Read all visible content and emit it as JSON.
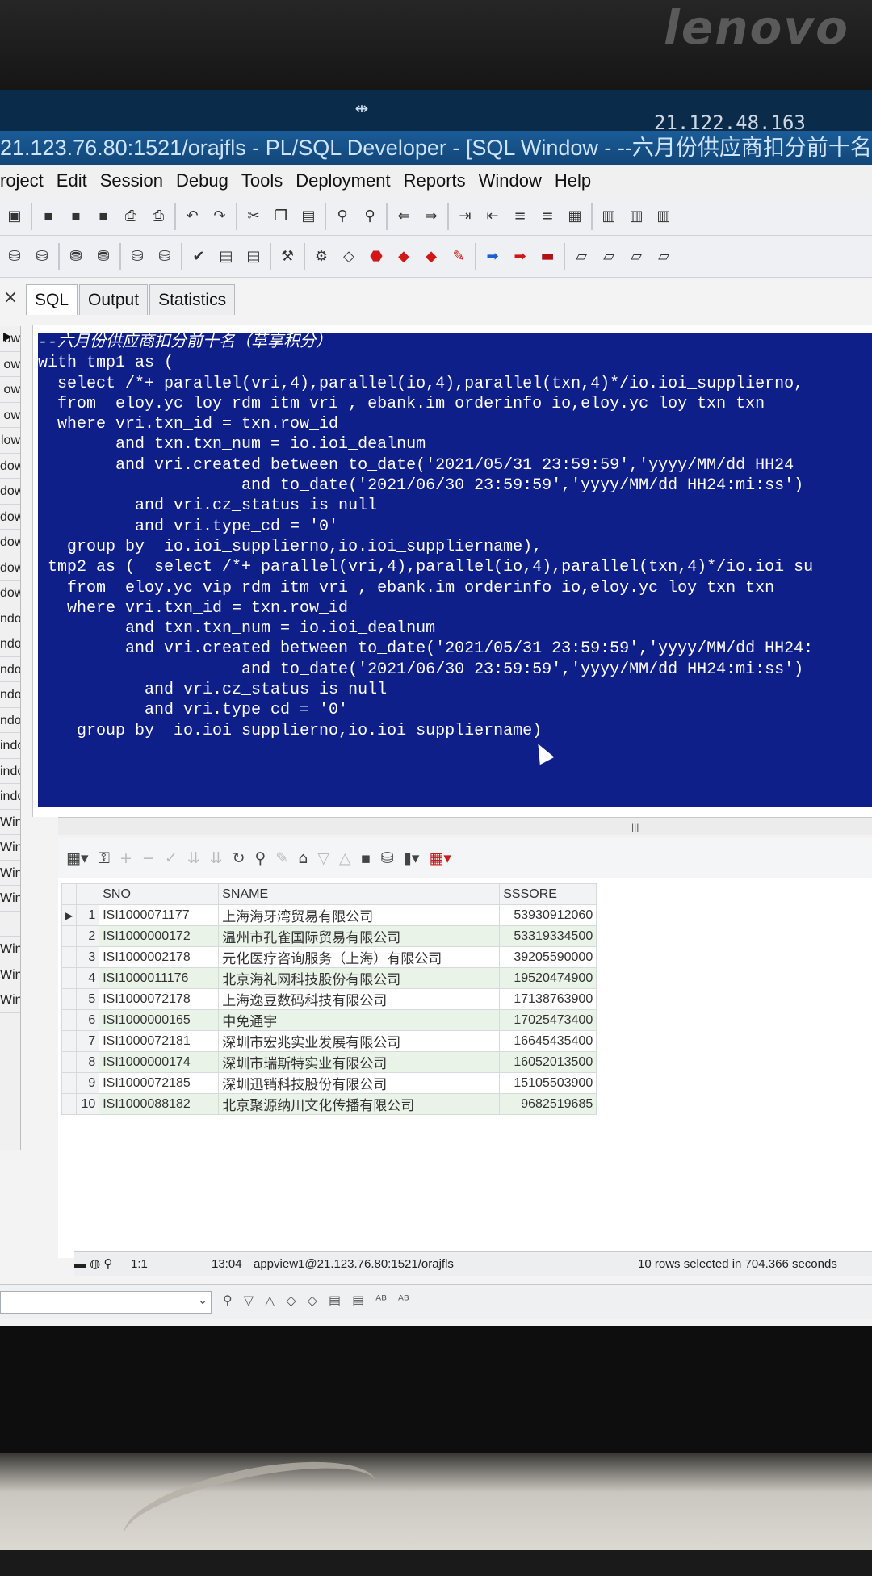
{
  "monitor": {
    "brand": "lenovo"
  },
  "remote": {
    "ip": "21.122.48.163"
  },
  "window": {
    "title": "21.123.76.80:1521/orajfls - PL/SQL Developer - [SQL Window - --六月份供应商扣分前十名 ("
  },
  "menu": [
    "roject",
    "Edit",
    "Session",
    "Debug",
    "Tools",
    "Deployment",
    "Reports",
    "Window",
    "Help"
  ],
  "tabs": [
    "SQL",
    "Output",
    "Statistics"
  ],
  "window_list": [
    "ow",
    "ow",
    "ow",
    "ow",
    "low",
    "dow",
    "dow",
    "dow",
    "dow",
    "dow",
    "dow",
    "ndow",
    "ndow",
    "ndow",
    "ndow",
    "ndow",
    "indow",
    "indow",
    "indow",
    "Window",
    "Window",
    "Window",
    "Window",
    "",
    "Window -",
    "Window -",
    "Window -"
  ],
  "code": [
    "--六月份供应商扣分前十名（草享积分）",
    "with tmp1 as (",
    "  select /*+ parallel(vri,4),parallel(io,4),parallel(txn,4)*/io.ioi_supplierno,",
    "  from  eloy.yc_loy_rdm_itm vri , ebank.im_orderinfo io,eloy.yc_loy_txn txn",
    "  where vri.txn_id = txn.row_id",
    "        and txn.txn_num = io.ioi_dealnum",
    "        and vri.created between to_date('2021/05/31 23:59:59','yyyy/MM/dd HH24",
    "                     and to_date('2021/06/30 23:59:59','yyyy/MM/dd HH24:mi:ss')",
    "          and vri.cz_status is null",
    "          and vri.type_cd = '0'",
    "   group by  io.ioi_supplierno,io.ioi_suppliername),",
    " tmp2 as (  select /*+ parallel(vri,4),parallel(io,4),parallel(txn,4)*/io.ioi_su",
    "   from  eloy.yc_vip_rdm_itm vri , ebank.im_orderinfo io,eloy.yc_loy_txn txn",
    "   where vri.txn_id = txn.row_id",
    "         and txn.txn_num = io.ioi_dealnum",
    "         and vri.created between to_date('2021/05/31 23:59:59','yyyy/MM/dd HH24:",
    "                     and to_date('2021/06/30 23:59:59','yyyy/MM/dd HH24:mi:ss')",
    "           and vri.cz_status is null",
    "           and vri.type_cd = '0'",
    "    group by  io.ioi_supplierno,io.ioi_suppliername)"
  ],
  "results": {
    "columns": [
      "SNO",
      "SNAME",
      "SSSORE"
    ],
    "rows": [
      {
        "n": "1",
        "sno": "ISI1000071177",
        "sname": "上海海牙湾贸易有限公司",
        "score": "53930912060"
      },
      {
        "n": "2",
        "sno": "ISI1000000172",
        "sname": "温州市孔雀国际贸易有限公司",
        "score": "53319334500"
      },
      {
        "n": "3",
        "sno": "ISI1000002178",
        "sname": "元化医疗咨询服务（上海）有限公司",
        "score": "39205590000"
      },
      {
        "n": "4",
        "sno": "ISI1000011176",
        "sname": "北京海礼网科技股份有限公司",
        "score": "19520474900"
      },
      {
        "n": "5",
        "sno": "ISI1000072178",
        "sname": "上海逸豆数码科技有限公司",
        "score": "17138763900"
      },
      {
        "n": "6",
        "sno": "ISI1000000165",
        "sname": "中免通宇",
        "score": "17025473400"
      },
      {
        "n": "7",
        "sno": "ISI1000072181",
        "sname": "深圳市宏兆实业发展有限公司",
        "score": "16645435400"
      },
      {
        "n": "8",
        "sno": "ISI1000000174",
        "sname": "深圳市瑞斯特实业有限公司",
        "score": "16052013500"
      },
      {
        "n": "9",
        "sno": "ISI1000072185",
        "sname": "深圳迅销科技股份有限公司",
        "score": "15105503900"
      },
      {
        "n": "10",
        "sno": "ISI1000088182",
        "sname": "北京聚源纳川文化传播有限公司",
        "score": "9682519685"
      }
    ]
  },
  "status": {
    "position": "1:1",
    "time": "13:04",
    "connection": "appview1@21.123.76.80:1521/orajfls",
    "message": "10 rows selected in 704.366 seconds"
  }
}
